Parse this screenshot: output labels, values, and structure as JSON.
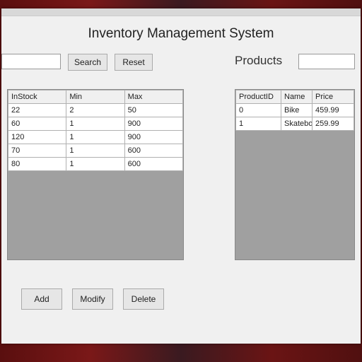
{
  "title": "Inventory Management System",
  "left": {
    "search_btn": "Search",
    "reset_btn": "Reset",
    "search_value": "",
    "columns": [
      "InStock",
      "Min",
      "Max"
    ],
    "rows": [
      [
        "22",
        "2",
        "50"
      ],
      [
        "60",
        "1",
        "900"
      ],
      [
        "120",
        "1",
        "900"
      ],
      [
        "70",
        "1",
        "600"
      ],
      [
        "80",
        "1",
        "600"
      ]
    ],
    "add_btn": "Add",
    "modify_btn": "Modify",
    "delete_btn": "Delete"
  },
  "right": {
    "label": "Products",
    "search_value": "",
    "columns": [
      "ProductID",
      "Name",
      "Price"
    ],
    "rows": [
      [
        "0",
        "Bike",
        "459.99"
      ],
      [
        "1",
        "Skateboard",
        "259.99"
      ]
    ]
  }
}
